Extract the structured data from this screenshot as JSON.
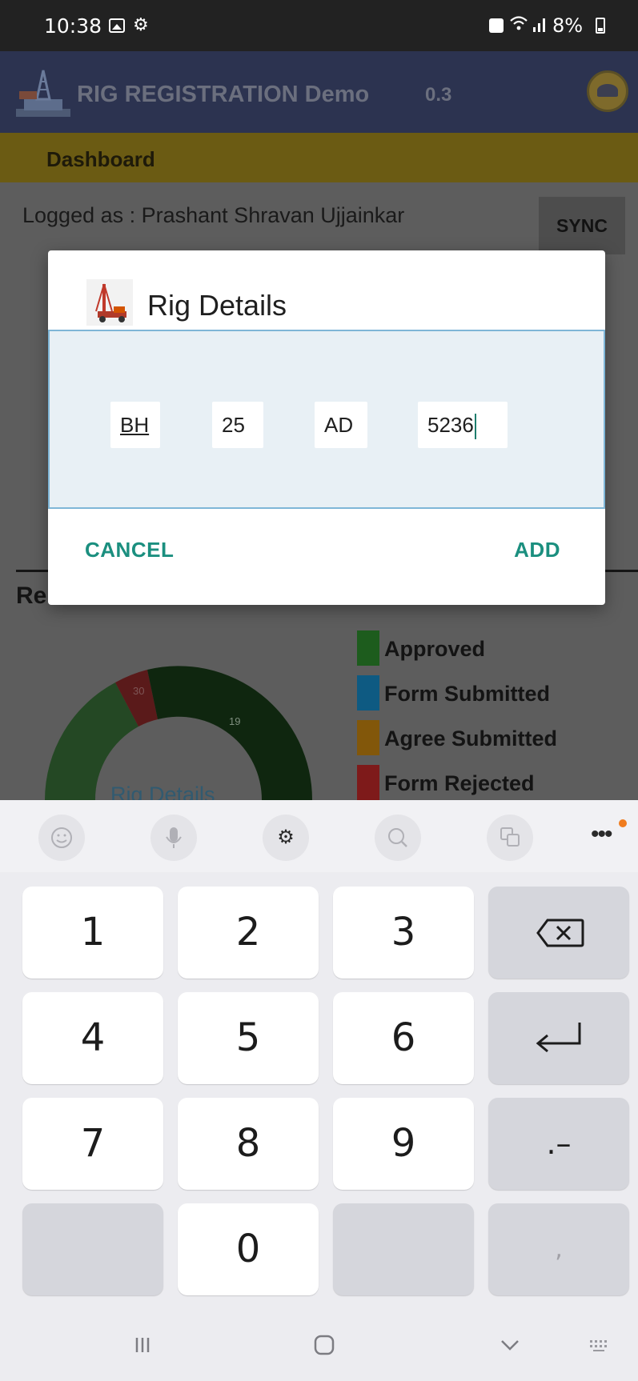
{
  "status_bar": {
    "time": "10:38",
    "battery": "8%",
    "icons": [
      "gallery-icon",
      "gear-icon",
      "lock-icon",
      "wifi-icon",
      "signal-icon",
      "battery-icon"
    ]
  },
  "app_bar": {
    "title": "RIG REGISTRATION Demo",
    "version": "0.3"
  },
  "dashboard": {
    "title": "Dashboard",
    "logged_as": "Logged as : Prashant Shravan Ujjainkar",
    "sync_label": "SYNC",
    "section_title_partial": "Re"
  },
  "chart": {
    "center_label": "Rig Details",
    "slice_labels": [
      "30",
      "19"
    ],
    "legend": [
      {
        "label": "Approved",
        "color": "#1d5c1d"
      },
      {
        "label": "Form Submitted",
        "color": "#0e5a82"
      },
      {
        "label": "Agree Submitted",
        "color": "#82570a"
      },
      {
        "label": "Form Rejected",
        "color": "#7e1a1a"
      }
    ]
  },
  "dialog": {
    "title": "Rig Details",
    "fields": [
      {
        "value": "BH"
      },
      {
        "value": "25"
      },
      {
        "value": "AD"
      },
      {
        "value": "5236"
      }
    ],
    "cancel_label": "CANCEL",
    "add_label": "ADD"
  },
  "keyboard": {
    "toolbar": [
      "emoji-icon",
      "mic-icon",
      "settings-icon",
      "search-icon",
      "translate-icon",
      "more-icon"
    ],
    "keys": {
      "k1": "1",
      "k2": "2",
      "k3": "3",
      "k4": "4",
      "k5": "5",
      "k6": "6",
      "k7": "7",
      "k8": "8",
      "k9": "9",
      "k0": "0",
      "dot_dash": ".–",
      "comma": ","
    }
  }
}
